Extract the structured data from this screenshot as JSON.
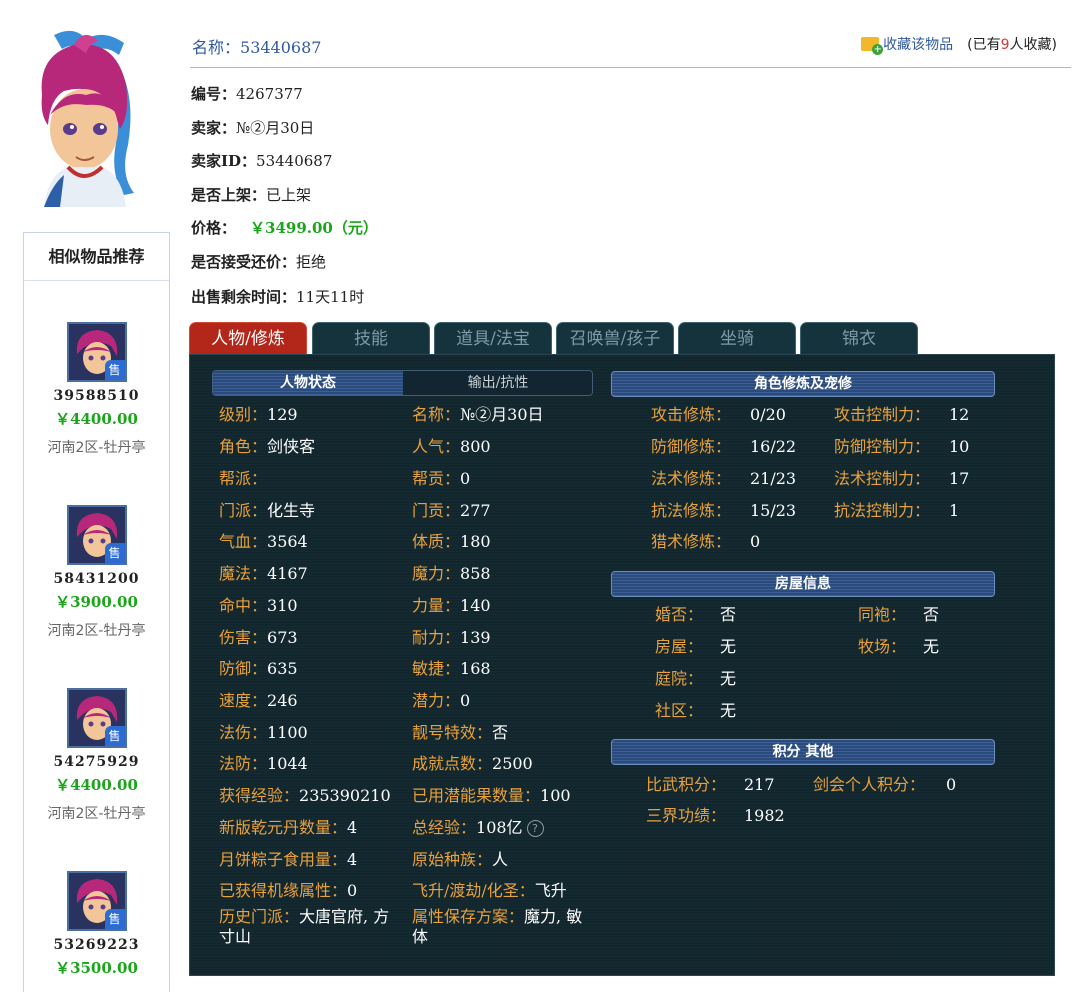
{
  "header": {
    "name_label": "名称：",
    "name_value": "53440687",
    "favorite_link": "收藏该物品",
    "favorite_count_prefix": "(已有",
    "favorite_count": "9",
    "favorite_count_suffix": "人收藏)"
  },
  "info": {
    "id_label": "编号：",
    "id_value": "4267377",
    "seller_label": "卖家：",
    "seller_value": "№②月30日",
    "seller_id_label": "卖家ID：",
    "seller_id_value": "53440687",
    "listed_label": "是否上架：",
    "listed_value": "已上架",
    "price_label": "价格：",
    "price_value": "￥3499.00（元）",
    "counter_label": "是否接受还价：",
    "counter_value": "拒绝",
    "time_label": "出售剩余时间：",
    "time_value": "11天11时"
  },
  "recommend": {
    "title": "相似物品推荐",
    "sell_badge": "售",
    "items": [
      {
        "id": "39588510",
        "price": "￥4400.00",
        "server": "河南2区-牡丹亭"
      },
      {
        "id": "58431200",
        "price": "￥3900.00",
        "server": "河南2区-牡丹亭"
      },
      {
        "id": "54275929",
        "price": "￥4400.00",
        "server": "河南2区-牡丹亭"
      },
      {
        "id": "53269223",
        "price": "￥3500.00",
        "server": ""
      }
    ]
  },
  "tabs": [
    "人物/修炼",
    "技能",
    "道具/法宝",
    "召唤兽/孩子",
    "坐骑",
    "锦衣"
  ],
  "panel": {
    "state_tab_active": "人物状态",
    "state_tab_other": "输出/抗性",
    "cultivation_title": "角色修炼及宠修",
    "house_title": "房屋信息",
    "score_title": "积分 其他",
    "left_stats": [
      {
        "k": "级别：",
        "v": "129"
      },
      {
        "k": "名称：",
        "v": "№②月30日"
      },
      {
        "k": "角色：",
        "v": "剑侠客"
      },
      {
        "k": "人气：",
        "v": "800"
      },
      {
        "k": "帮派：",
        "v": ""
      },
      {
        "k": "帮贡：",
        "v": "0"
      },
      {
        "k": "门派：",
        "v": "化生寺"
      },
      {
        "k": "门贡：",
        "v": "277"
      },
      {
        "k": "气血：",
        "v": "3564"
      },
      {
        "k": "体质：",
        "v": "180"
      },
      {
        "k": "魔法：",
        "v": "4167"
      },
      {
        "k": "魔力：",
        "v": "858"
      },
      {
        "k": "命中：",
        "v": "310"
      },
      {
        "k": "力量：",
        "v": "140"
      },
      {
        "k": "伤害：",
        "v": "673"
      },
      {
        "k": "耐力：",
        "v": "139"
      },
      {
        "k": "防御：",
        "v": "635"
      },
      {
        "k": "敏捷：",
        "v": "168"
      },
      {
        "k": "速度：",
        "v": "246"
      },
      {
        "k": "潜力：",
        "v": "0"
      },
      {
        "k": "法伤：",
        "v": "1100"
      },
      {
        "k": "靓号特效：",
        "v": "否"
      },
      {
        "k": "法防：",
        "v": "1044"
      },
      {
        "k": "成就点数：",
        "v": "2500"
      },
      {
        "k": "获得经验：",
        "v": "235390210"
      },
      {
        "k": "已用潜能果数量：",
        "v": "100"
      },
      {
        "k": "新版乾元丹数量：",
        "v": "4"
      },
      {
        "k": "总经验：",
        "v": "108亿"
      },
      {
        "k": "月饼粽子食用量：",
        "v": "4"
      },
      {
        "k": "原始种族：",
        "v": "人"
      },
      {
        "k": "已获得机缘属性：",
        "v": "0"
      },
      {
        "k": "飞升/渡劫/化圣：",
        "v": "飞升"
      }
    ],
    "history_label": "历史门派：",
    "history_line1": "大唐官府, 方",
    "history_line2": "寸山",
    "attr_label": "属性保存方案：",
    "attr_line1": "魔力, 敏",
    "attr_line2": "体",
    "help_icon": "?",
    "cultivation": [
      {
        "k": "攻击修炼：",
        "v": "0/20",
        "k2": "攻击控制力：",
        "v2": "12"
      },
      {
        "k": "防御修炼：",
        "v": "16/22",
        "k2": "防御控制力：",
        "v2": "10"
      },
      {
        "k": "法术修炼：",
        "v": "21/23",
        "k2": "法术控制力：",
        "v2": "17"
      },
      {
        "k": "抗法修炼：",
        "v": "15/23",
        "k2": "抗法控制力：",
        "v2": "1"
      },
      {
        "k": "猎术修炼：",
        "v": "0",
        "k2": "",
        "v2": ""
      }
    ],
    "house": [
      {
        "k": "婚否：",
        "v": "否",
        "k2": "同袍：",
        "v2": "否"
      },
      {
        "k": "房屋：",
        "v": "无",
        "k2": "牧场：",
        "v2": "无"
      },
      {
        "k": "庭院：",
        "v": "无",
        "k2": "",
        "v2": ""
      },
      {
        "k": "社区：",
        "v": "无",
        "k2": "",
        "v2": ""
      }
    ],
    "score": [
      {
        "k": "比武积分：",
        "v": "217",
        "k2": "剑会个人积分：",
        "v2": "0"
      },
      {
        "k": "三界功绩：",
        "v": "1982",
        "k2": "",
        "v2": ""
      }
    ]
  }
}
